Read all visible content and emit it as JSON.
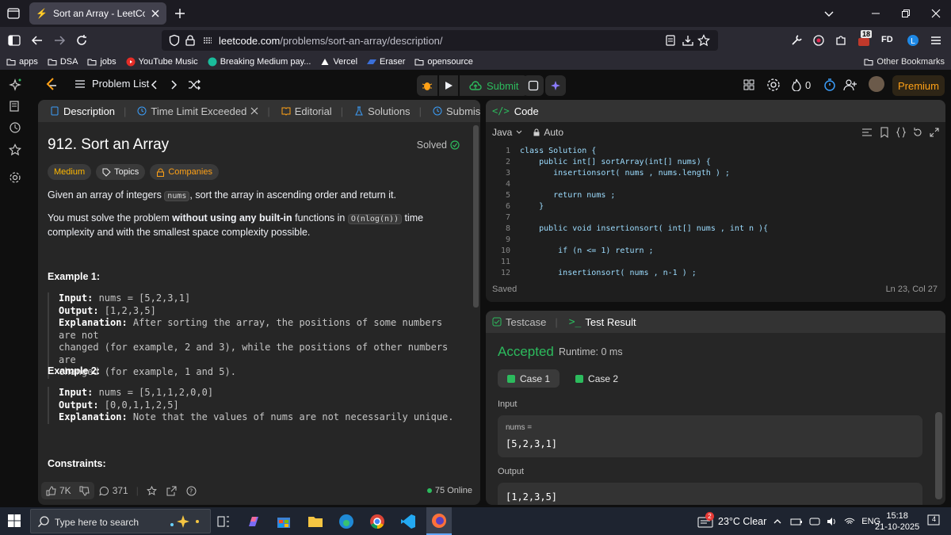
{
  "browser": {
    "tab_title": "Sort an Array - LeetCode",
    "url_domain": "leetcode.com",
    "url_path": "/problems/sort-an-array/description/",
    "ext_badge": "18",
    "profile_initials": "FD"
  },
  "bookmarks": {
    "items": [
      {
        "label": "apps",
        "icon": "folder-icon"
      },
      {
        "label": "DSA",
        "icon": "folder-icon"
      },
      {
        "label": "jobs",
        "icon": "folder-icon"
      },
      {
        "label": "YouTube Music",
        "icon": "youtube-music-icon"
      },
      {
        "label": "Breaking Medium pay...",
        "icon": "site-icon"
      },
      {
        "label": "Vercel",
        "icon": "vercel-icon"
      },
      {
        "label": "Eraser",
        "icon": "eraser-icon"
      },
      {
        "label": "opensource",
        "icon": "folder-icon"
      }
    ],
    "other": "Other Bookmarks"
  },
  "lc_top": {
    "problem_list": "Problem List",
    "submit": "Submit",
    "fire_count": "0",
    "premium": "Premium"
  },
  "left_tabs": [
    {
      "label": "Description"
    },
    {
      "label": "Time Limit Exceeded"
    },
    {
      "label": "Editorial"
    },
    {
      "label": "Solutions"
    },
    {
      "label": "Submissions"
    }
  ],
  "problem": {
    "title": "912. Sort an Array",
    "solved": "Solved",
    "tags": {
      "difficulty": "Medium",
      "topics": "Topics",
      "companies": "Companies"
    },
    "p1_a": "Given an array of integers ",
    "p1_code": "nums",
    "p1_b": ", sort the array in ascending order and return it.",
    "p2_a": "You must solve the problem ",
    "p2_bold": "without using any built-in",
    "p2_b": " functions in ",
    "p2_code": "O(nlog(n))",
    "p2_c": " time complexity and with the smallest space complexity possible.",
    "ex1_title": "Example 1:",
    "ex1": {
      "input_k": "Input:",
      "input_v": " nums = [5,2,3,1]",
      "output_k": "Output:",
      "output_v": " [1,2,3,5]",
      "expl_k": "Explanation:",
      "expl_l1": " After sorting the array, the positions of some numbers are not",
      "expl_l2": "changed (for example, 2 and 3), while the positions of other numbers are",
      "expl_l3": "changed (for example, 1 and 5)."
    },
    "ex2_title": "Example 2:",
    "ex2": {
      "input_k": "Input:",
      "input_v": " nums = [5,1,1,2,0,0]",
      "output_k": "Output:",
      "output_v": " [0,0,1,1,2,5]",
      "expl_k": "Explanation:",
      "expl_l1": " Note that the values of nums are not necessarily unique."
    },
    "constraints": "Constraints:"
  },
  "footer": {
    "likes": "7K",
    "comments": "371",
    "online": "75 Online"
  },
  "code": {
    "header": "Code",
    "language": "Java",
    "mode": "Auto",
    "lines": [
      {
        "n": "1",
        "t": "class Solution {"
      },
      {
        "n": "2",
        "t": "    public int[] sortArray(int[] nums) {"
      },
      {
        "n": "3",
        "t": "       insertionsort( nums , nums.length ) ;"
      },
      {
        "n": "4",
        "t": ""
      },
      {
        "n": "5",
        "t": "       return nums ;"
      },
      {
        "n": "6",
        "t": "    }"
      },
      {
        "n": "7",
        "t": ""
      },
      {
        "n": "8",
        "t": "    public void insertionsort( int[] nums , int n ){"
      },
      {
        "n": "9",
        "t": ""
      },
      {
        "n": "10",
        "t": "        if (n <= 1) return ;"
      },
      {
        "n": "11",
        "t": ""
      },
      {
        "n": "12",
        "t": "        insertionsort( nums , n-1 ) ;"
      }
    ],
    "status": "Saved",
    "cursor": "Ln 23, Col 27"
  },
  "result": {
    "tab_testcase": "Testcase",
    "tab_result": "Test Result",
    "verdict": "Accepted",
    "runtime": "Runtime: 0 ms",
    "cases": [
      "Case 1",
      "Case 2"
    ],
    "input_label": "Input",
    "input_key": "nums =",
    "input_value": "[5,2,3,1]",
    "output_label": "Output",
    "output_value": "[1,2,3,5]"
  },
  "taskbar": {
    "search_placeholder": "Type here to search",
    "weather_badge": "2",
    "weather": "23°C  Clear",
    "lang": "ENG",
    "time": "15:18",
    "date": "21-10-2025",
    "notif": "4"
  },
  "colors": {
    "accent_green": "#2cbb5d",
    "accent_orange": "#ffa116",
    "medium": "#ffb800"
  }
}
